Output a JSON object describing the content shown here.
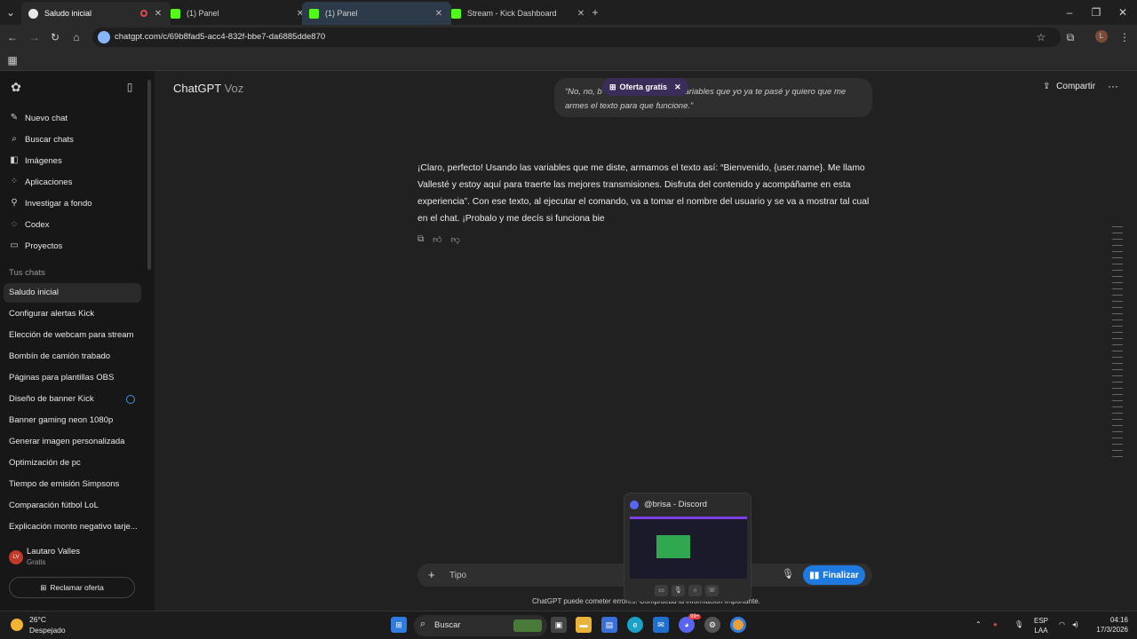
{
  "browser": {
    "tabs": [
      {
        "title": "Saludo inicial",
        "active": true,
        "favicon_color": "#e8e8e8"
      },
      {
        "title": "(1) Panel",
        "active": false,
        "favicon_color": "#53fc18"
      },
      {
        "title": "(1) Panel",
        "active": false,
        "favicon_color": "#53fc18"
      },
      {
        "title": "Stream - Kick Dashboard",
        "active": false,
        "favicon_color": "#53fc18"
      }
    ],
    "url": "chatgpt.com/c/69b8fad5-acc4-832f-bbe7-da6885dde870",
    "profile_initial": "L"
  },
  "sidebar": {
    "nav": [
      {
        "label": "Nuevo chat",
        "icon": "edit-icon"
      },
      {
        "label": "Buscar chats",
        "icon": "search-icon"
      },
      {
        "label": "Imágenes",
        "icon": "image-icon"
      },
      {
        "label": "Aplicaciones",
        "icon": "apps-icon"
      },
      {
        "label": "Investigar a fondo",
        "icon": "research-icon"
      },
      {
        "label": "Codex",
        "icon": "codex-icon"
      },
      {
        "label": "Proyectos",
        "icon": "folder-icon"
      }
    ],
    "section_label": "Tus chats",
    "chats": [
      "Saludo inicial",
      "Configurar alertas Kick",
      "Elección de webcam para stream",
      "Bombín de camión trabado",
      "Páginas para plantillas OBS",
      "Diseño de banner Kick",
      "Banner gaming neon 1080p",
      "Generar imagen personalizada",
      "Optimización de pc",
      "Tiempo de emisión Simpsons",
      "Comparación fútbol LoL",
      "Explicación monto negativo tarje..."
    ],
    "user": {
      "initials": "LV",
      "name": "Lautaro Valles",
      "plan": "Gratis"
    },
    "claim_label": "Reclamar oferta"
  },
  "header": {
    "model": "ChatGPT",
    "mode": "Voz",
    "share_label": "Compartir",
    "promo_label": "Oferta gratis"
  },
  "conversation": {
    "user_message": "“No, no, b... variables que yo ya te pasé y quiero que me armes el texto para que funcione.”",
    "user_message_start": "“No, no, b",
    "user_message_rest": "variables que yo ya te pasé y quiero que me armes el texto para que funcione.”",
    "assistant_message": "¡Claro, perfecto! Usando las variables que me diste, armamos el texto así: “Bienvenido, {user.name}. Me llamo Vallesté y estoy aquí para traerte las mejores transmisiones. Disfruta del contenido y acompáñame en esta experiencia”. Con ese texto, al ejecutar el comando, va a tomar el nombre del usuario y se va a mostrar tal cual en el chat. ¡Probalo y me decís si funciona bie"
  },
  "composer": {
    "placeholder": "Tipo",
    "finish_label": "Finalizar",
    "disclaimer": "ChatGPT puede cometer errores. Comprueba la información importante."
  },
  "discord_preview": {
    "title": "@brisa - Discord"
  },
  "taskbar": {
    "temperature": "26°C",
    "weather": "Despejado",
    "search_label": "Buscar",
    "lang_top": "ESP",
    "lang_bottom": "LAA",
    "time": "04:16",
    "date": "17/3/2026",
    "discord_badge": "99+"
  }
}
